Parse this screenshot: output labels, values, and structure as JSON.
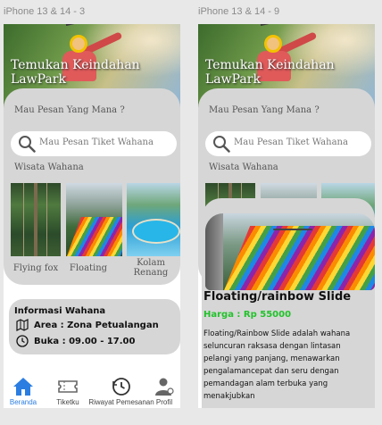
{
  "frames": [
    {
      "label": "iPhone 13 & 14 - 3",
      "hero_title": "Temukan Keindahan LawPark",
      "question": "Mau Pesan Yang Mana ?",
      "search_placeholder": "Mau Pesan Tiket Wahana",
      "section_title": "Wisata Wahana",
      "rides": [
        {
          "name": "Flying fox"
        },
        {
          "name": "Floating"
        },
        {
          "name": "Kolam Renang"
        }
      ],
      "info": {
        "title": "Informasi Wahana",
        "area": "Area : Zona Petualangan",
        "hours": "Buka : 09.00 - 17.00"
      },
      "nav": [
        {
          "label": "Beranda",
          "icon": "home-icon",
          "active": true
        },
        {
          "label": "Tiketku",
          "icon": "ticket-icon"
        },
        {
          "label": "Riwayat Pemesanan",
          "icon": "history-icon"
        },
        {
          "label": "Profil",
          "icon": "profile-icon"
        }
      ]
    },
    {
      "label": "iPhone 13 & 14 - 9",
      "hero_title": "Temukan Keindahan LawPark",
      "question": "Mau Pesan Yang Mana ?",
      "search_placeholder": "Mau Pesan Tiket Wahana",
      "section_title": "Wisata Wahana",
      "detail": {
        "title": "Floating/rainbow Slide",
        "price": "Harga : Rp 55000",
        "description": "Floating/Rainbow Slide adalah wahana seluncuran raksasa dengan lintasan pelangi yang panjang, menawarkan pengalamancepat dan seru dengan pemandagan alam terbuka yang menakjubkan"
      }
    }
  ],
  "colors": {
    "card_gray": "#d6d6d6",
    "active_nav": "#2b7de1",
    "price_green": "#22c22b"
  }
}
